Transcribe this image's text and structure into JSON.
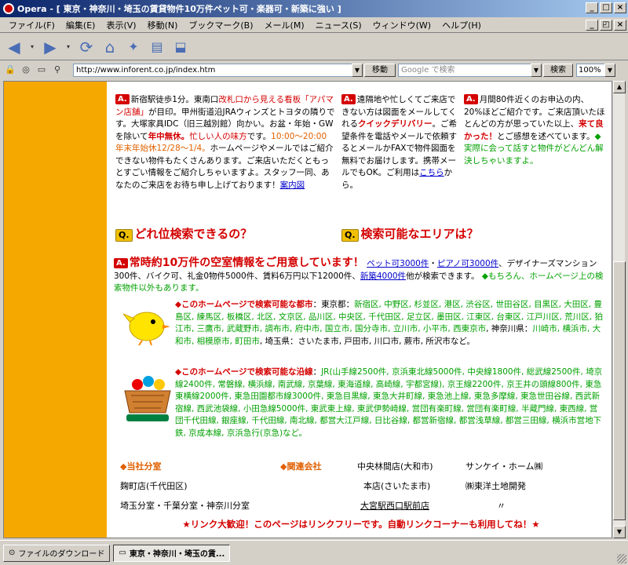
{
  "window": {
    "title": "Opera - [ 東京・神奈川・埼玉の賃貸物件10万件ペット可・楽器可・新築に強い ]"
  },
  "menu": [
    "ファイル(F)",
    "編集(E)",
    "表示(V)",
    "移動(N)",
    "ブックマーク(B)",
    "メール(M)",
    "ニュース(S)",
    "ウィンドウ(W)",
    "ヘルプ(H)"
  ],
  "address": {
    "url": "http://www.inforent.co.jp/index.htm",
    "go_label": "移動",
    "search_placeholder": "Google で検索",
    "search_label": "検索",
    "zoom": "100%"
  },
  "col1": {
    "badge": "A.",
    "t1": "新宿駅徒歩1分。東南口",
    "t2": "改札口から見える看板「アパマン店舗」",
    "t3": "が目印。甲州街道沿JRAウィンズとトヨタの隣りです。大塚家具IDC（旧三越別館）向かい。お盆・年始・GWを除いて",
    "t4": "年中無休。",
    "t5": "忙しい人の味方",
    "t6": "です。",
    "t7": "10:00～20:00 年末年始休12/28～1/4。",
    "t8": "ホームページやメールではご紹介できない物件もたくさんあります。ご来店いただくともっとすごい情報をご紹介しちゃいますよ。スタッフ一同、あなたのご来店をお待ち申し上げております！",
    "link": "案内図"
  },
  "col2": {
    "badge": "A.",
    "t1": "遠隔地や忙しくてご来店できない方は図面をメールしてくれる",
    "t2": "クイックデリバリー",
    "t3": "。ご希望条件を電話やメールで依頼するとメールかFAXで物件図面を無料でお届けします。携帯メールでもOK。ご利用は",
    "link": "こちら",
    "t4": "から。"
  },
  "col3": {
    "badge": "A.",
    "t1": "月間80件近くのお申込の内、20%ほどご紹介です。ご来店頂いたほとんどの方が思っていた以上、",
    "t2": "来て良かった！",
    "t3": "とご感想を述べています。",
    "t4": "◆実際に会って話すと物件がどんどん解決しちゃいますよ。"
  },
  "q1": {
    "badge": "Q.",
    "text": "どれ位検索できるの？"
  },
  "q2": {
    "badge": "Q.",
    "text": "検索可能なエリアは？"
  },
  "a2": {
    "badge": "A.",
    "head": "常時約10万件の空室情報をご用意しています！",
    "link1": "ペット可3000件",
    "sep": "・",
    "link2": "ピアノ可3000件",
    "t1": "、デザイナーズマンション300件、バイク可、礼金0物件5000件、賃料6万円以下12000件、",
    "link3": "新築4000件",
    "t2": "他が検索できます。",
    "t3": "◆もちろん、ホームページ上の検索物件以外もあります。"
  },
  "area": {
    "label": "◆このホームページで検索可能な都市",
    "colon": "：",
    "tokyo_label": "東京都",
    "tokyo": "新宿区, 中野区, 杉並区, 港区, 渋谷区, 世田谷区, 目黒区, 大田区, 豊島区, 練馬区, 板橋区, 北区, 文京区, 品川区, 中央区, 千代田区, 足立区, 墨田区, 江東区, 台東区, 江戸川区, 荒川区, 狛江市, 三鷹市, 武蔵野市, 調布市, 府中市, 国立市, 国分寺市, 立川市, 小平市, 西東京市",
    "kanagawa_label": "神奈川県",
    "kanagawa": "川崎市, 横浜市, 大和市, 相模原市, 町田市",
    "saitama_label": "埼玉県",
    "saitama": "さいたま市, 戸田市, 川口市, 蕨市, 所沢市など。"
  },
  "lines": {
    "label": "◆このホームページで検索可能な沿線",
    "colon": "：",
    "text": "JR(山手線2500件, 京浜東北線5000件, 中央線1800件, 総武線2500件, 埼京線2400件, 常磐線, 横浜線, 南武線, 京葉線, 東海道線, 高崎線, 宇都宮線), 京王線2200件, 京王井の頭線800件, 東急東横線2000件, 東急田園都市線3000件, 東急目黒線, 東急大井町線, 東急池上線, 東急多摩線, 東急世田谷線, 西武新宿線, 西武池袋線, 小田急線5000件, 東武東上線, 東武伊勢崎線, 営団有楽町線, 営団有楽町線, 半蔵門線, 東西線, 営団千代田線, 銀座線, 千代田線, 南北線, 都営大江戸線, 日比谷線, 都営新宿線, 都営浅草線, 都営三田線, 横浜市営地下鉄, 京成本線, 京浜急行(京急)など。"
  },
  "branches": {
    "own_label": "◆当社分室",
    "related_label": "◆関連会社",
    "r1": "中央林間店(大和市)",
    "r2": "サンケイ・ホーム㈱",
    "b1": "麹町店(千代田区)",
    "r3": "本店(さいたま市)",
    "r4": "㈱東洋土地開発",
    "b2": "埼玉分室・千葉分室・神奈川分室",
    "r5": "大宮駅西口駅前店",
    "r6": "〃"
  },
  "footer": "★リンク大歓迎！このページはリンクフリーです。自動リンクコーナーも利用してね！★",
  "statusbar": {
    "downloads": "ファイルのダウンロード",
    "tab": "東京・神奈川・埼玉の賃..."
  }
}
